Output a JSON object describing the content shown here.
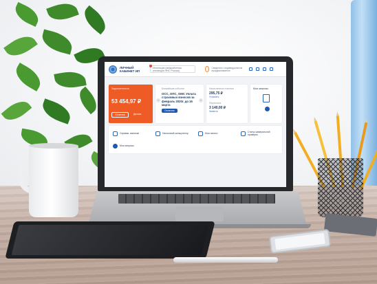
{
  "screen": {
    "header": {
      "brand": "ЛИЧНЫЙ КАБИНЕТ ИП",
      "inspection_select": "Инспекция (межрайонная инспекция ФНС России)",
      "person_text": "Сведения о индивидуальном предпринимателе"
    },
    "debt_card": {
      "label": "Задолженность",
      "amount": "53 454,97 ₽",
      "pay_button": "Оплатить",
      "details_link": "Детали"
    },
    "events_card": {
      "title": "Ближайшие события",
      "text": "ОСС, ОПС, ОМС Уплата страховых взносов за февраль 2020г. до 16 марта",
      "button": "Оплатить"
    },
    "accruals_card": {
      "title_1": "Начисленные платежи",
      "value_1": "295,75 ₽",
      "link_1": "Уточнить",
      "title_2": "Переплата",
      "value_2": "3 140,00 ₽",
      "link_2": "Зачесть"
    },
    "documents_card": {
      "title": "Мои запросы"
    },
    "quick_links": [
      "Справки, выписки",
      "Налоговый калькулятор",
      "Мои налоги",
      "Статус камеральной проверки",
      "Мои запросы"
    ]
  },
  "colors": {
    "accent_orange": "#ee5b24",
    "brand_blue": "#1f58b3"
  }
}
